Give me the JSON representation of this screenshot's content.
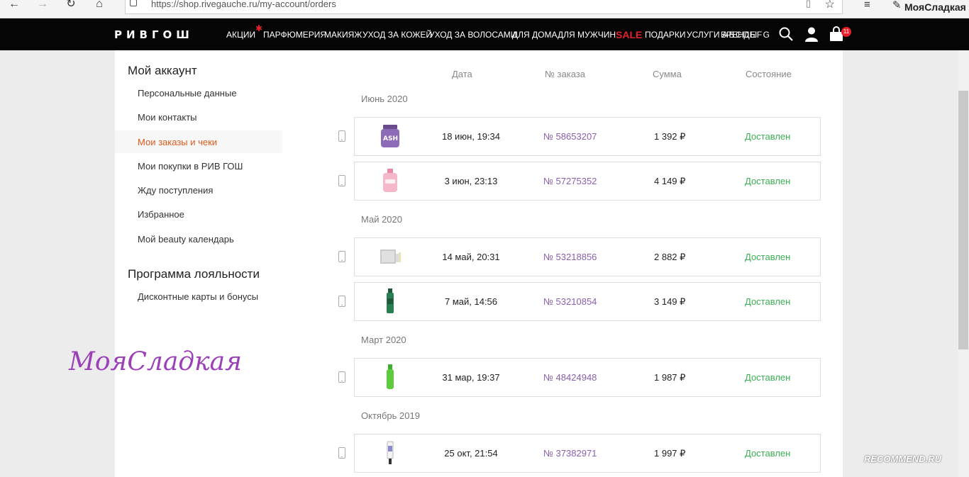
{
  "browser": {
    "url": "https://shop.rivegauche.ru/my-account/orders",
    "profile_name": "МояСладкая",
    "back_icon": "arrow-left-icon",
    "forward_icon": "arrow-right-icon",
    "refresh_icon": "refresh-icon",
    "home_icon": "home-icon"
  },
  "header": {
    "logo": "РИВГОШ",
    "menu": [
      "АКЦИИ",
      "ПАРФЮМЕРИЯ",
      "МАКИЯЖ",
      "УХОД ЗА КОЖЕЙ",
      "УХОД ЗА ВОЛОСАМИ",
      "ДЛЯ ДОМА",
      "ДЛЯ МУЖЧИН",
      "SALE",
      "ПОДАРКИ",
      "УСЛУГИ",
      "БРЕНДЫ"
    ],
    "brand_letters": "ABCDEFG",
    "cart_count": "11",
    "accent_color": "#e4202a"
  },
  "sidebar": {
    "account_title": "Мой аккаунт",
    "items": [
      "Персональные данные",
      "Мои контакты",
      "Мои заказы и чеки",
      "Мои покупки в РИВ ГОШ",
      "Жду поступления",
      "Избранное",
      "Мой beauty календарь"
    ],
    "loyalty_title": "Программа лояльности",
    "loyalty_items": [
      "Дисконтные карты и бонусы"
    ]
  },
  "table": {
    "headers": [
      "Дата",
      "№ заказа",
      "Сумма",
      "Состояние"
    ]
  },
  "months": [
    "Июнь 2020",
    "Май 2020",
    "Март 2020",
    "Октябрь 2019"
  ],
  "orders": [
    {
      "date": "18 июн, 19:34",
      "number": "№ 58653207",
      "sum": "1 392 ₽",
      "status": "Доставлен"
    },
    {
      "date": "3 июн, 23:13",
      "number": "№ 57275352",
      "sum": "4 149 ₽",
      "status": "Доставлен"
    },
    {
      "date": "14 май, 20:31",
      "number": "№ 53218856",
      "sum": "2 882 ₽",
      "status": "Доставлен"
    },
    {
      "date": "7 май, 14:56",
      "number": "№ 53210854",
      "sum": "3 149 ₽",
      "status": "Доставлен"
    },
    {
      "date": "31 мар, 19:37",
      "number": "№ 48424948",
      "sum": "1 987 ₽",
      "status": "Доставлен"
    },
    {
      "date": "25 окт, 21:54",
      "number": "№ 37382971",
      "sum": "1 997 ₽",
      "status": "Доставлен"
    }
  ],
  "watermark": "МояСладкая",
  "irecommend": "RECOMMEND.RU"
}
